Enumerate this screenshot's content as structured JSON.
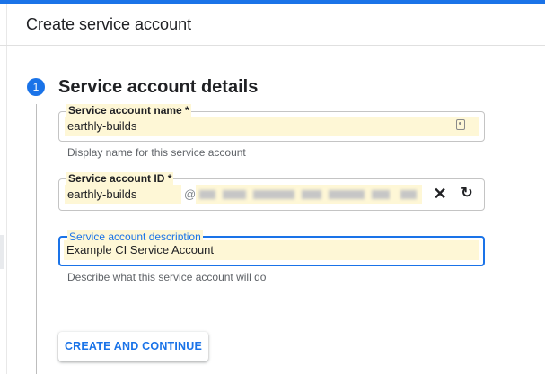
{
  "header": {
    "title": "Create service account"
  },
  "step": {
    "number": "1",
    "title": "Service account details"
  },
  "fields": {
    "name": {
      "label": "Service account name *",
      "value": "earthly-builds",
      "helper": "Display name for this service account",
      "icon": "contact-card-icon"
    },
    "id": {
      "label": "Service account ID *",
      "value": "earthly-builds",
      "at_symbol": "@",
      "domain_redacted": true,
      "clear_icon": "close-icon",
      "refresh_icon": "refresh-icon"
    },
    "description": {
      "label": "Service account description",
      "value": "Example CI Service Account",
      "helper": "Describe what this service account will do"
    }
  },
  "actions": {
    "create_label": "CREATE AND CONTINUE"
  },
  "colors": {
    "accent": "#1a73e8",
    "autofill": "#fef7d6",
    "helper_text": "#5f6368"
  }
}
